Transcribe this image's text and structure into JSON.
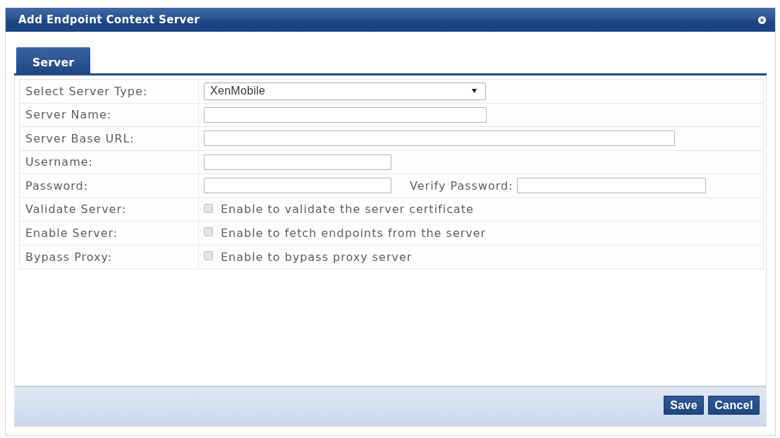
{
  "window": {
    "title": "Add Endpoint Context Server"
  },
  "tabs": [
    {
      "label": "Server",
      "selected": true
    }
  ],
  "form": {
    "rows": [
      {
        "kind": "select",
        "label": "Select Server Type:",
        "value": "XenMobile"
      },
      {
        "kind": "text",
        "label": "Server Name:"
      },
      {
        "kind": "text",
        "label": "Server Base URL:"
      },
      {
        "kind": "text",
        "label": "Username:"
      },
      {
        "kind": "password_pair",
        "label": "Password:",
        "second_label": "Verify Password:"
      },
      {
        "kind": "checkbox",
        "label": "Validate Server:",
        "text": "Enable to validate the server certificate",
        "checked": false
      },
      {
        "kind": "checkbox",
        "label": "Enable Server:",
        "text": "Enable to fetch endpoints from the server",
        "checked": false
      },
      {
        "kind": "checkbox",
        "label": "Bypass Proxy:",
        "text": "Enable to bypass proxy server",
        "checked": false
      }
    ]
  },
  "buttons": [
    {
      "label": "Save"
    },
    {
      "label": "Cancel"
    }
  ]
}
